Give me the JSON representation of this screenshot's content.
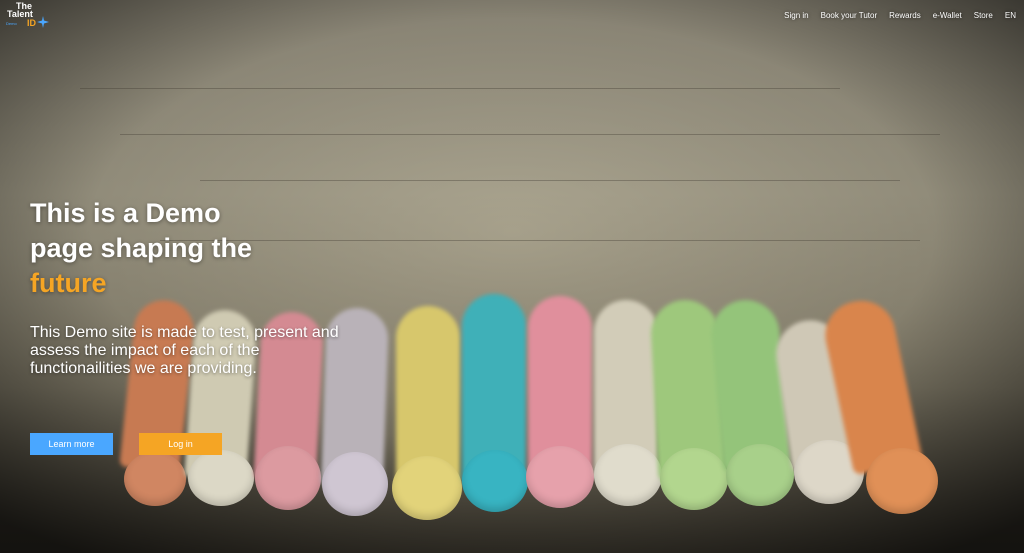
{
  "brand": {
    "line1": "The",
    "line2": "Talent",
    "demo": "Demo",
    "id": "ID",
    "accent": "#f5a524",
    "blue": "#4aa7ff"
  },
  "nav": {
    "items": [
      {
        "label": "Sign in"
      },
      {
        "label": "Book your Tutor"
      },
      {
        "label": "Rewards"
      },
      {
        "label": "e-Wallet"
      },
      {
        "label": "Store"
      },
      {
        "label": "EN"
      }
    ]
  },
  "hero": {
    "title_line1": "This is a Demo",
    "title_line2": "page shaping the",
    "title_accent": "future",
    "description": "This Demo site is made to test, present and assess the impact of each of the functionailities we are providing.",
    "buttons": {
      "learn_more": "Learn more",
      "log_in": "Log in"
    }
  }
}
